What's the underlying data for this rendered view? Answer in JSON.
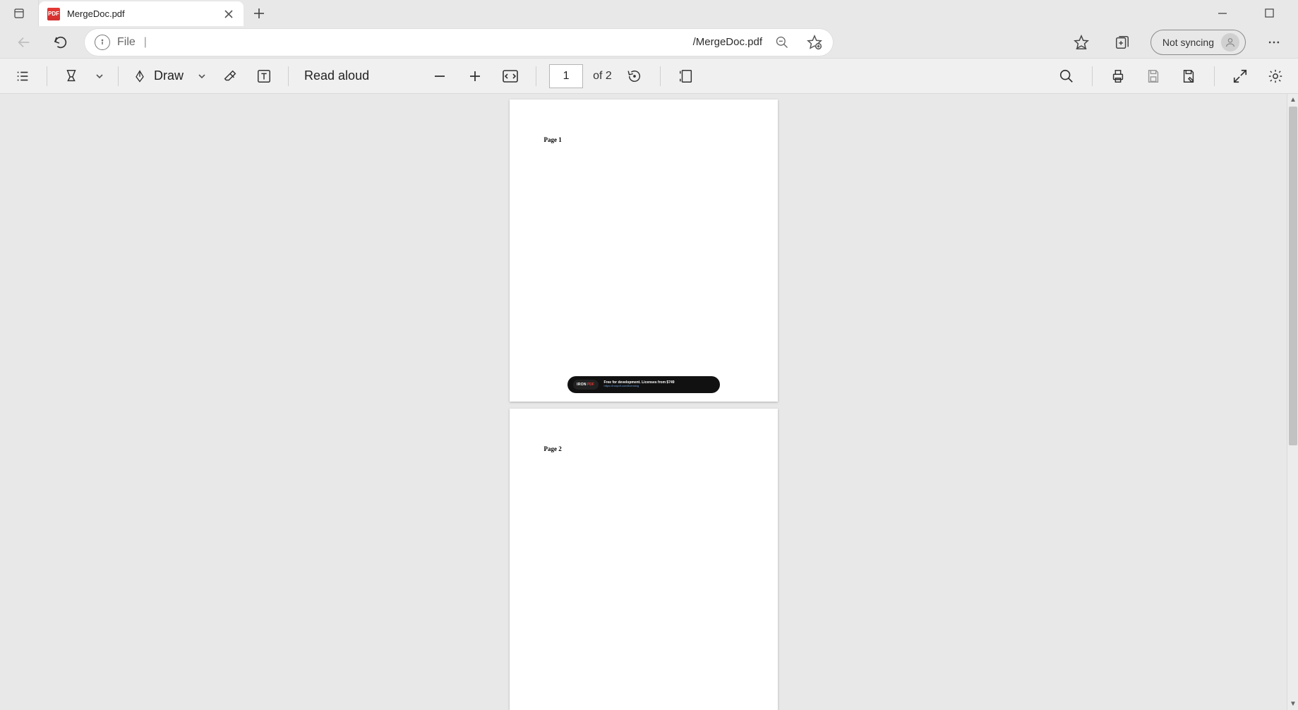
{
  "tab": {
    "title": "MergeDoc.pdf",
    "favicon_text": "PDF"
  },
  "address": {
    "scheme": "File",
    "path": "/MergeDoc.pdf"
  },
  "sync": {
    "label": "Not syncing"
  },
  "pdf_toolbar": {
    "draw_label": "Draw",
    "read_aloud_label": "Read aloud",
    "page_current": "1",
    "page_of": "of 2"
  },
  "document": {
    "pages": [
      {
        "label": "Page 1"
      },
      {
        "label": "Page 2"
      }
    ],
    "watermark": {
      "logo_iron": "IRON",
      "logo_pdf": "PDF",
      "line1": "Free for development. Licenses from $749",
      "line2": "https://ironpdf.com/licensing"
    }
  }
}
